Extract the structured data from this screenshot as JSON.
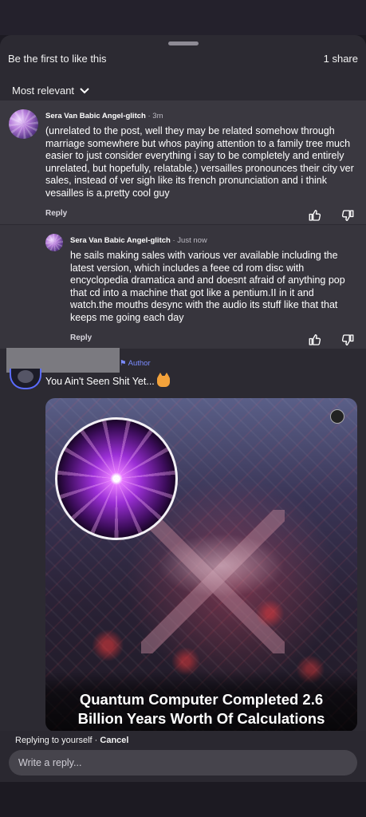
{
  "header": {
    "likes_text": "Be the first to like this",
    "shares_text": "1 share",
    "sort_label": "Most relevant"
  },
  "comments": [
    {
      "name": "Sera Van Babic Angel-glitch",
      "time": "3m",
      "text": "(unrelated to the post, well they may be related somehow through marriage somewhere but whos paying attention to a family tree much easier to just consider everything i say to be completely and entirely unrelated, but hopefully, relatable.) versailles pronounces their city ver sales, instead of ver sigh like its french pronunciation and i think vesailles is a.pretty cool guy",
      "reply_label": "Reply"
    },
    {
      "name": "Sera Van Babic Angel-glitch",
      "time": "Just now",
      "text": "he sails making sales with various ver available including the latest version, which includes a feee cd rom disc with encyclopedia dramatica and and doesnt afraid of anything pop that cd into a machine that got like a pentium.II in it and watch.the mouths desync with the audio its stuff like that that keeps me going each day",
      "reply_label": "Reply"
    }
  ],
  "author_post": {
    "author_tag": "Author",
    "text": "You Ain't Seen Shit Yet...",
    "emoji": "scared-cat-emoji",
    "image_caption_line1": "Quantum Computer Completed 2.6",
    "image_caption_line2": "Billion Years Worth Of Calculations"
  },
  "compose": {
    "replying_text": "Replying to yourself",
    "separator": " · ",
    "cancel_label": "Cancel",
    "placeholder": "Write a reply..."
  },
  "colors": {
    "sheet_bg": "#2c2a32",
    "comment_bg": "#3a3840",
    "author_accent": "#7b8cff"
  }
}
